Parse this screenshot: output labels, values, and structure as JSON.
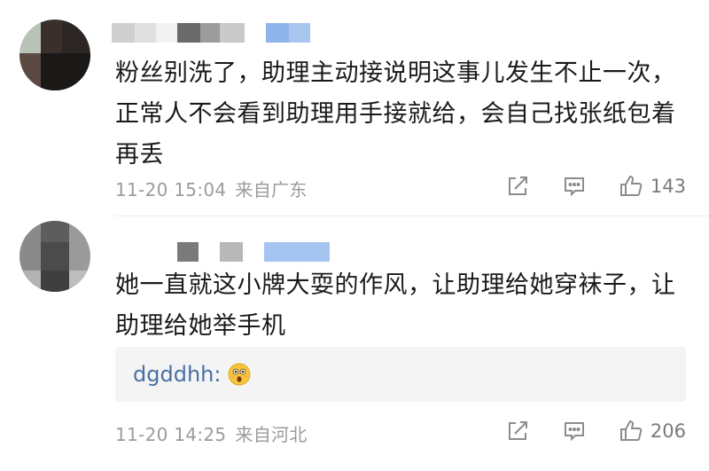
{
  "comments": [
    {
      "text": "粉丝别洗了，助理主动接说明这事儿发生不止一次，正常人不会看到助理用手接就给，会自己找张纸包着再丢",
      "time": "11-20 15:04",
      "location": "来自广东",
      "likes": "143"
    },
    {
      "text": "她一直就这小牌大耍的作风，让助理给她穿袜子，让助理给她举手机",
      "time": "11-20 14:25",
      "location": "来自河北",
      "likes": "206",
      "reply": {
        "user": "dgddhh",
        "colon": ":",
        "emoji": "astonished-face-emoji"
      }
    }
  ],
  "icons": {
    "share": "share-icon",
    "reply": "comment-icon",
    "like": "thumbs-up-icon"
  },
  "colors": {
    "link": "#4a6fa5",
    "meta": "#9b9b9b",
    "text": "#1a1a1a",
    "reply_bg": "#f4f4f4"
  }
}
